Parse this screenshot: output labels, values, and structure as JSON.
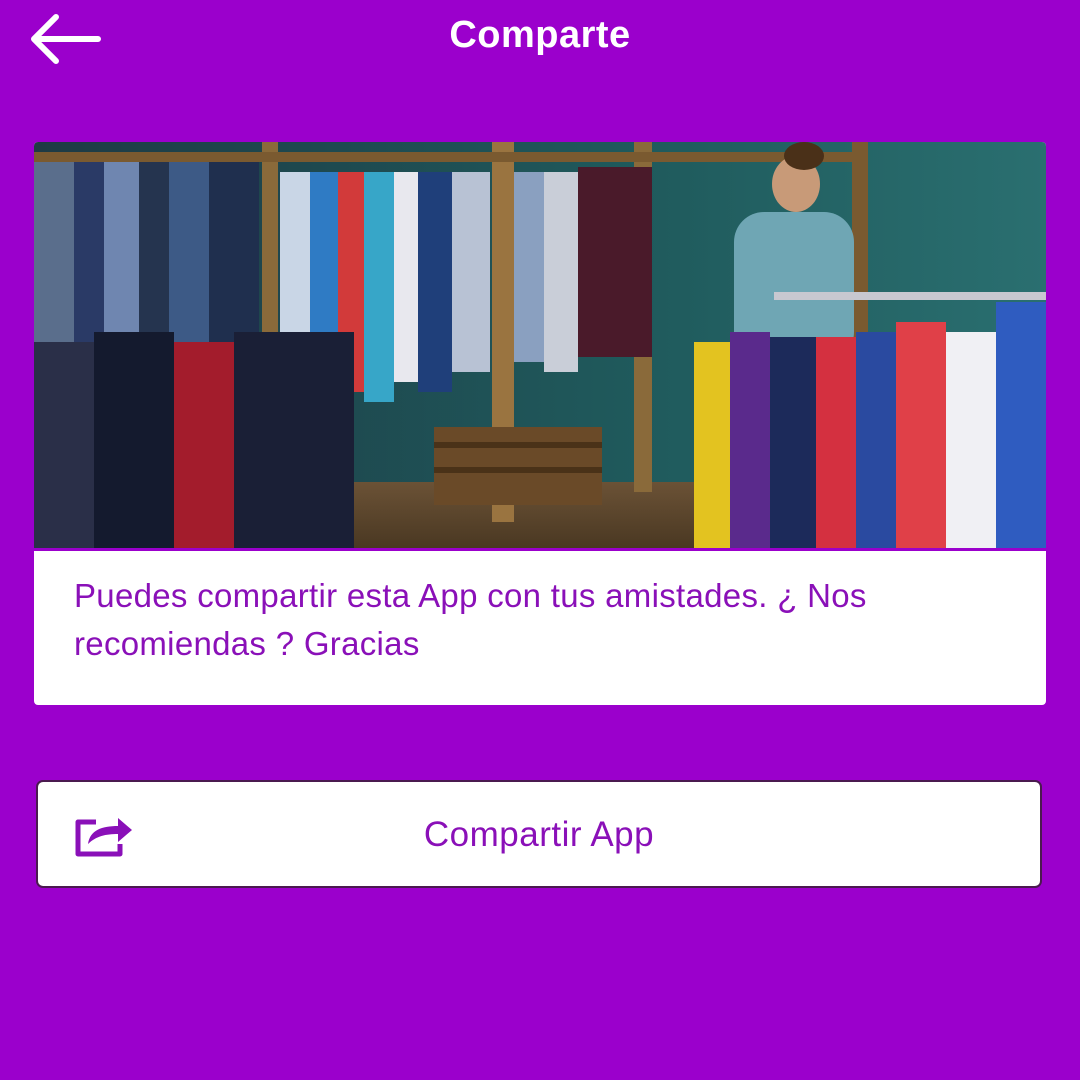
{
  "header": {
    "title": "Comparte",
    "back_icon": "arrow-left-icon"
  },
  "card": {
    "image_alt": "Tienda de ropa con percheros de camisas",
    "text": "Puedes compartir esta App con tus amistades. ¿ Nos recomiendas ? Gracias"
  },
  "share_button": {
    "label": "Compartir App",
    "icon": "share-icon"
  },
  "colors": {
    "background": "#9b00cc",
    "header_text": "#ffffff",
    "accent_text": "#8a10b8",
    "card_bg": "#ffffff",
    "divider": "#9b00cc"
  }
}
